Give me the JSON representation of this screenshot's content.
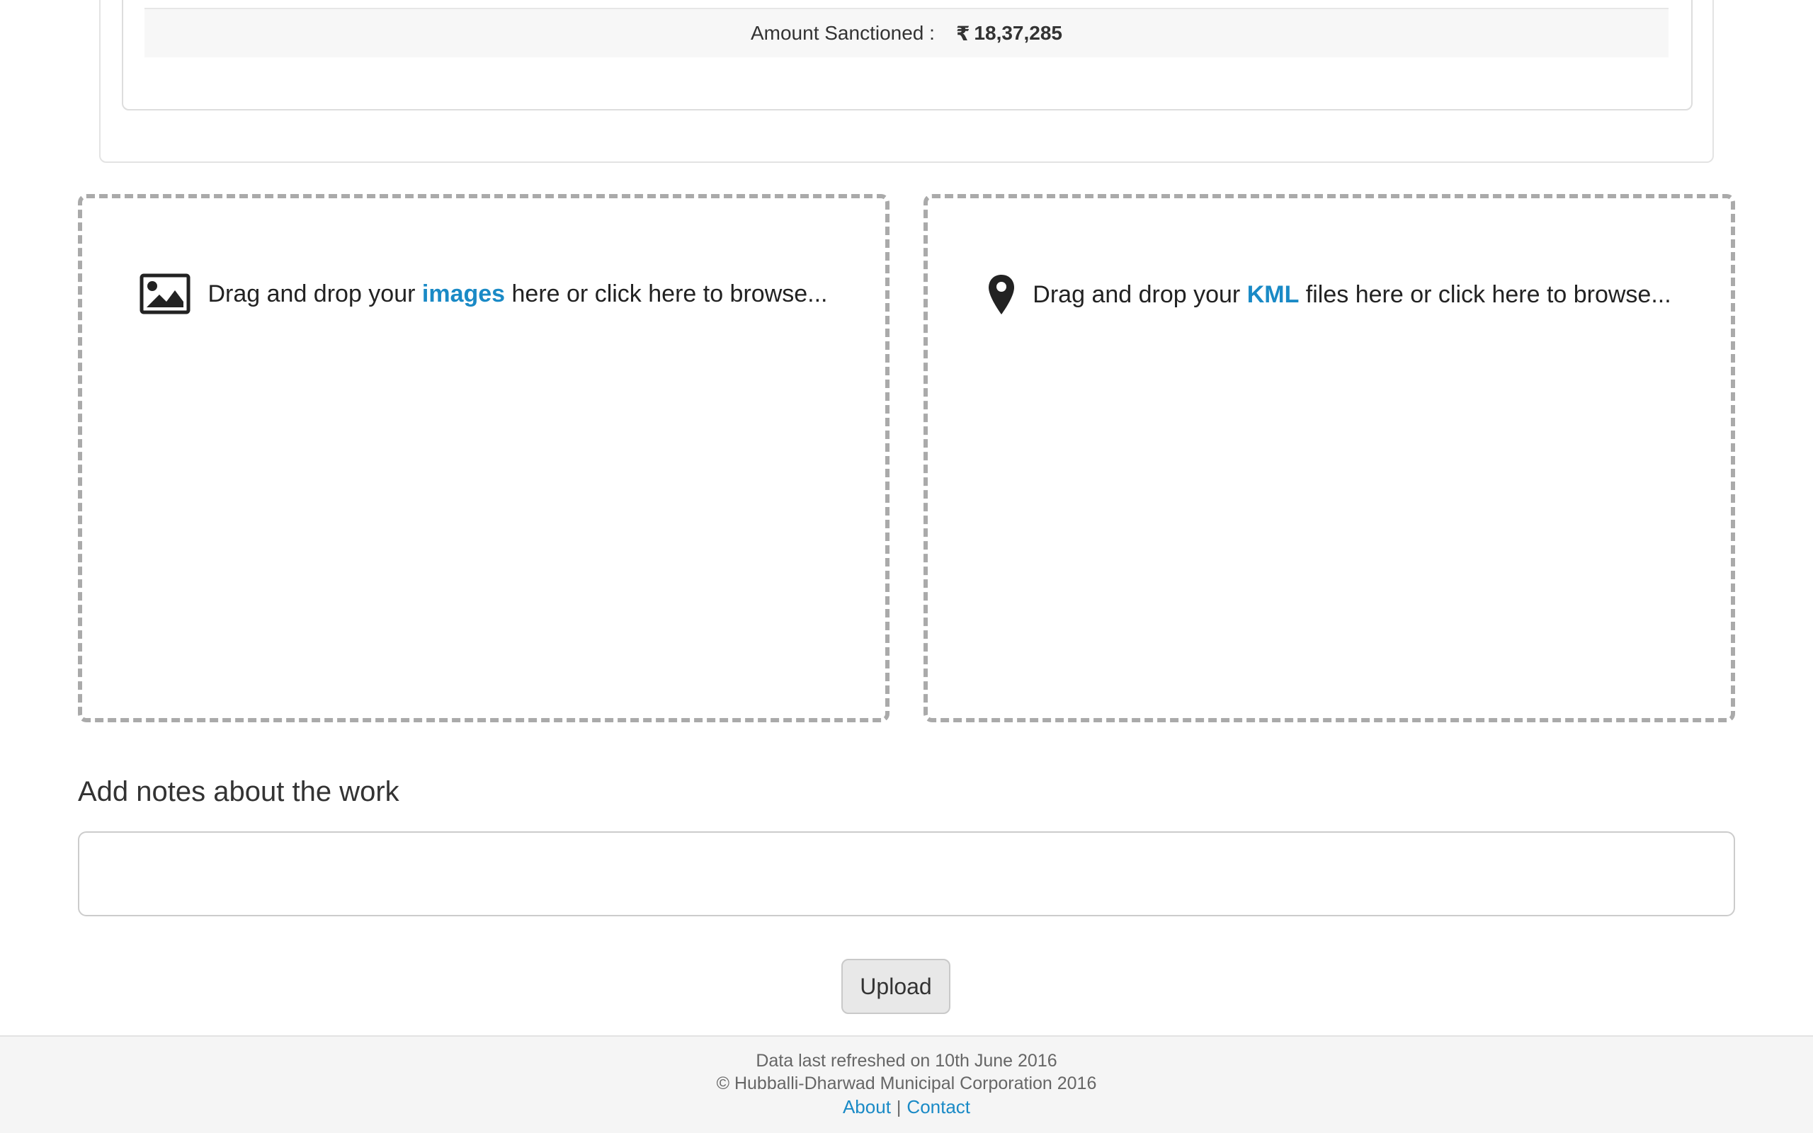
{
  "sanction": {
    "label": "Amount Sanctioned :",
    "currency_symbol": "₹",
    "amount": "18,37,285"
  },
  "image_dropzone": {
    "icon": "image-icon",
    "prefix": "Drag and drop your ",
    "highlight": "images",
    "suffix": " here or click here to browse..."
  },
  "kml_dropzone": {
    "icon": "map-marker-icon",
    "prefix": "Drag and drop your ",
    "highlight": "KML",
    "suffix": " files here or click here to browse..."
  },
  "notes": {
    "label": "Add notes about the work",
    "value": "",
    "placeholder": ""
  },
  "actions": {
    "upload_label": "Upload"
  },
  "footer": {
    "refreshed": "Data last refreshed on 10th June 2016",
    "copyright": "© Hubballi-Dharwad Municipal Corporation 2016",
    "about_label": "About",
    "separator": "|",
    "contact_label": "Contact"
  },
  "colors": {
    "accent": "#1a8ac6",
    "dropzone_border": "#aaaaaa",
    "footer_bg": "#f5f5f5"
  }
}
